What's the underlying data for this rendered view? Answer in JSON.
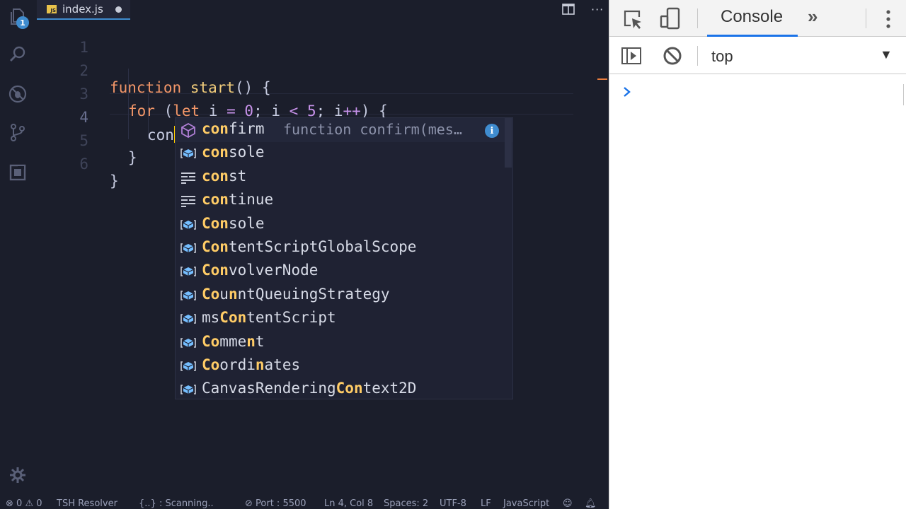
{
  "editor": {
    "activity_badge": "1",
    "tab": {
      "file_icon": "JS",
      "filename": "index.js"
    },
    "lines": [
      {
        "number": "1"
      },
      {
        "number": "2"
      },
      {
        "number": "3"
      },
      {
        "number": "4"
      },
      {
        "number": "5"
      },
      {
        "number": "6"
      }
    ],
    "code": {
      "l2_kw": "function",
      "l2_name": "start",
      "l2_rest": "() {",
      "l3_for": "for",
      "l3_p1": " (",
      "l3_let": "let",
      "l3_i1": " i ",
      "l3_eq": "=",
      "l3_zero": " 0",
      "l3_semi1": "; i ",
      "l3_lt": "<",
      "l3_five": " 5",
      "l3_semi2": "; i",
      "l3_inc": "++",
      "l3_end": ") {",
      "l4_typed": "con",
      "l5_brace": "}",
      "l6_brace": "}"
    }
  },
  "suggest": {
    "items": [
      {
        "kind": "cube-icon",
        "hl": "con",
        "rest": "firm",
        "pre": ""
      },
      {
        "kind": "variable-icon",
        "hl": "con",
        "rest": "sole",
        "pre": ""
      },
      {
        "kind": "keyword-icon",
        "hl": "con",
        "rest": "st",
        "pre": ""
      },
      {
        "kind": "keyword-icon",
        "hl": "con",
        "rest": "tinue",
        "pre": ""
      },
      {
        "kind": "variable-icon",
        "hl": "Con",
        "rest": "sole",
        "pre": ""
      },
      {
        "kind": "variable-icon",
        "hl": "Con",
        "rest": "tentScriptGlobalScope",
        "pre": ""
      },
      {
        "kind": "variable-icon",
        "hl": "Con",
        "rest": "volverNode",
        "pre": ""
      },
      {
        "kind": "variable-icon",
        "hl": "Co",
        "rest": "untQueuingStrategy",
        "pre": "",
        "hl2": "n",
        "hl2_pos": 1
      },
      {
        "kind": "variable-icon",
        "hl": "Con",
        "rest": "tentScript",
        "pre": "ms"
      },
      {
        "kind": "variable-icon",
        "hl": "Co",
        "rest": "mme",
        "pre": "",
        "hl2": "n",
        "tail": "t"
      },
      {
        "kind": "variable-icon",
        "hl": "Co",
        "rest": "ordi",
        "pre": "",
        "hl2": "n",
        "tail": "ates"
      },
      {
        "kind": "variable-icon",
        "hl": "Con",
        "rest": "text2D",
        "pre": "CanvasRendering"
      }
    ],
    "detail": "function confirm(mes…",
    "info_glyph": "i"
  },
  "statusbar": {
    "errors": "0",
    "warnings": "0",
    "resolver": "TSH Resolver",
    "scanning": "{..} : Scanning..",
    "port": "Port : 5500",
    "position": "Ln 4, Col 8",
    "spaces": "Spaces: 2",
    "encoding": "UTF-8",
    "eol": "LF",
    "language": "JavaScript"
  },
  "devtools": {
    "tab_console": "Console",
    "more_tabs": "»",
    "context": "top",
    "context_arrow": "▼",
    "accent": "#1a73e8"
  }
}
